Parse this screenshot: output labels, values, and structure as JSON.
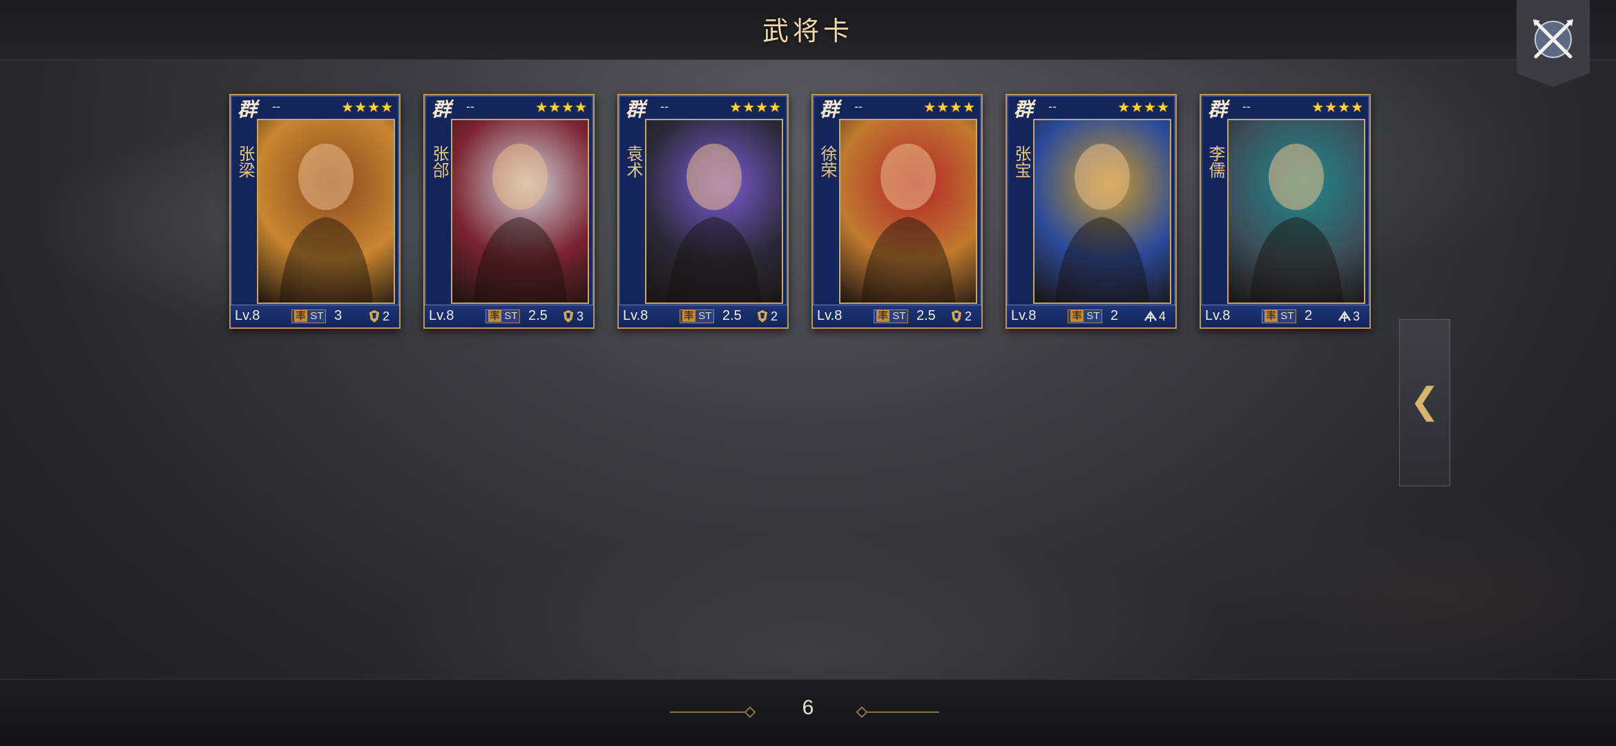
{
  "header": {
    "title": "武将卡"
  },
  "cards": [
    {
      "faction": "群",
      "dash": "--",
      "stars": "★★★★",
      "name": "张梁",
      "level": "Lv.8",
      "cost_label": "率",
      "cost_prefix": "ST",
      "cost": "3",
      "troop_icon": "shield-icon",
      "troop": "2",
      "portrait_bg": "#c9862f",
      "portrait_accent": "#8c4a20"
    },
    {
      "faction": "群",
      "dash": "--",
      "stars": "★★★★",
      "name": "张郃",
      "level": "Lv.8",
      "cost_label": "率",
      "cost_prefix": "ST",
      "cost": "2.5",
      "troop_icon": "shield-icon",
      "troop": "3",
      "portrait_bg": "#7b2330",
      "portrait_accent": "#cfd3d8"
    },
    {
      "faction": "群",
      "dash": "--",
      "stars": "★★★★",
      "name": "袁术",
      "level": "Lv.8",
      "cost_label": "率",
      "cost_prefix": "ST",
      "cost": "2.5",
      "troop_icon": "shield-icon",
      "troop": "2",
      "portrait_bg": "#2b2a3a",
      "portrait_accent": "#7e5bd6"
    },
    {
      "faction": "群",
      "dash": "--",
      "stars": "★★★★",
      "name": "徐荣",
      "level": "Lv.8",
      "cost_label": "率",
      "cost_prefix": "ST",
      "cost": "2.5",
      "troop_icon": "shield-icon",
      "troop": "2",
      "portrait_bg": "#c07a2f",
      "portrait_accent": "#b3262a"
    },
    {
      "faction": "群",
      "dash": "--",
      "stars": "★★★★",
      "name": "张宝",
      "level": "Lv.8",
      "cost_label": "率",
      "cost_prefix": "ST",
      "cost": "2",
      "troop_icon": "crossbow-icon",
      "troop": "4",
      "portrait_bg": "#2b4a9a",
      "portrait_accent": "#c79a2a"
    },
    {
      "faction": "群",
      "dash": "--",
      "stars": "★★★★",
      "name": "李儒",
      "level": "Lv.8",
      "cost_label": "率",
      "cost_prefix": "ST",
      "cost": "2",
      "troop_icon": "crossbow-icon",
      "troop": "3",
      "portrait_bg": "#3c4f5a",
      "portrait_accent": "#1f8a8a"
    }
  ],
  "side_tab": {
    "arrow": "❮"
  },
  "footer": {
    "page": "6"
  }
}
